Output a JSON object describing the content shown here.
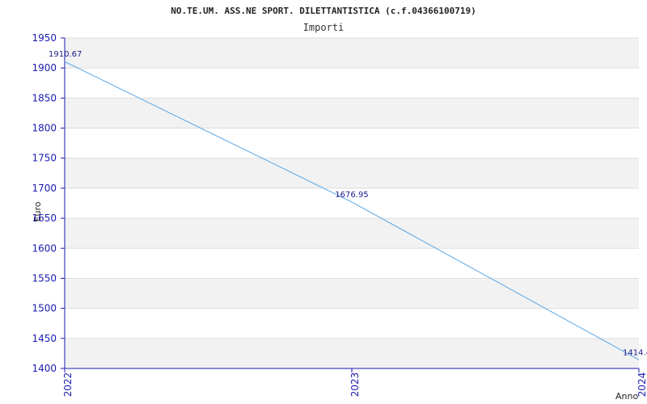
{
  "chart_data": {
    "type": "line",
    "title": "NO.TE.UM. ASS.NE SPORT. DILETTANTISTICA (c.f.04366100719)",
    "subtitle": "Importi",
    "xlabel": "Anno",
    "ylabel": "Euro",
    "categories": [
      "2022",
      "2023",
      "2024"
    ],
    "series": [
      {
        "values": [
          1910.67,
          1676.95,
          1414.4
        ],
        "labels": [
          "1910.67",
          "1676.95",
          "1414.4"
        ]
      }
    ],
    "ylim": [
      1400,
      1950
    ],
    "yticks": [
      "1400",
      "1450",
      "1500",
      "1550",
      "1600",
      "1650",
      "1700",
      "1750",
      "1800",
      "1850",
      "1900",
      "1950"
    ],
    "grid": true,
    "colors": {
      "line": "#5aa7e6",
      "band": "#f2f2f2",
      "axis": "#1a1ab0",
      "grid": "#dddddd"
    }
  }
}
